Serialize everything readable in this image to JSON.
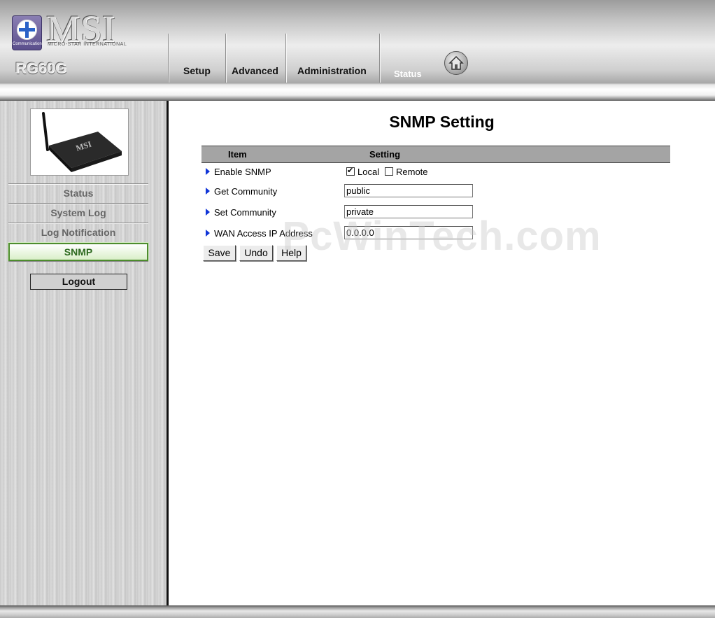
{
  "brand": {
    "name": "MSI",
    "subtitle": "MICRO-STAR INTERNATIONAL",
    "logo_caption": "Communication",
    "model": "RG60G"
  },
  "nav": {
    "tabs": [
      {
        "label": "Setup"
      },
      {
        "label": "Advanced"
      },
      {
        "label": "Administration"
      },
      {
        "label": "Status",
        "active": true
      }
    ],
    "home_icon": "home-icon"
  },
  "sidebar": {
    "device_image": "router-photo",
    "device_label": "MSI",
    "items": [
      {
        "label": "Status"
      },
      {
        "label": "System Log"
      },
      {
        "label": "Log Notification"
      },
      {
        "label": "SNMP",
        "active": true
      }
    ],
    "logout_label": "Logout"
  },
  "main": {
    "title": "SNMP Setting",
    "table": {
      "col_item": "Item",
      "col_setting": "Setting"
    },
    "rows": {
      "enable_snmp": {
        "label": "Enable SNMP",
        "local_label": "Local",
        "local_checked": true,
        "remote_label": "Remote",
        "remote_checked": false
      },
      "get_community": {
        "label": "Get Community",
        "value": "public"
      },
      "set_community": {
        "label": "Set Community",
        "value": "private"
      },
      "wan_access": {
        "label": "WAN Access IP Address",
        "value": "0.0.0.0"
      }
    },
    "buttons": {
      "save": "Save",
      "undo": "Undo",
      "help": "Help"
    },
    "watermark": "PcWinTech.com"
  },
  "colors": {
    "accent_arrow": "#1035d8",
    "active_side_border": "#4d8c2d",
    "header_bg": "#c4c4c4"
  }
}
